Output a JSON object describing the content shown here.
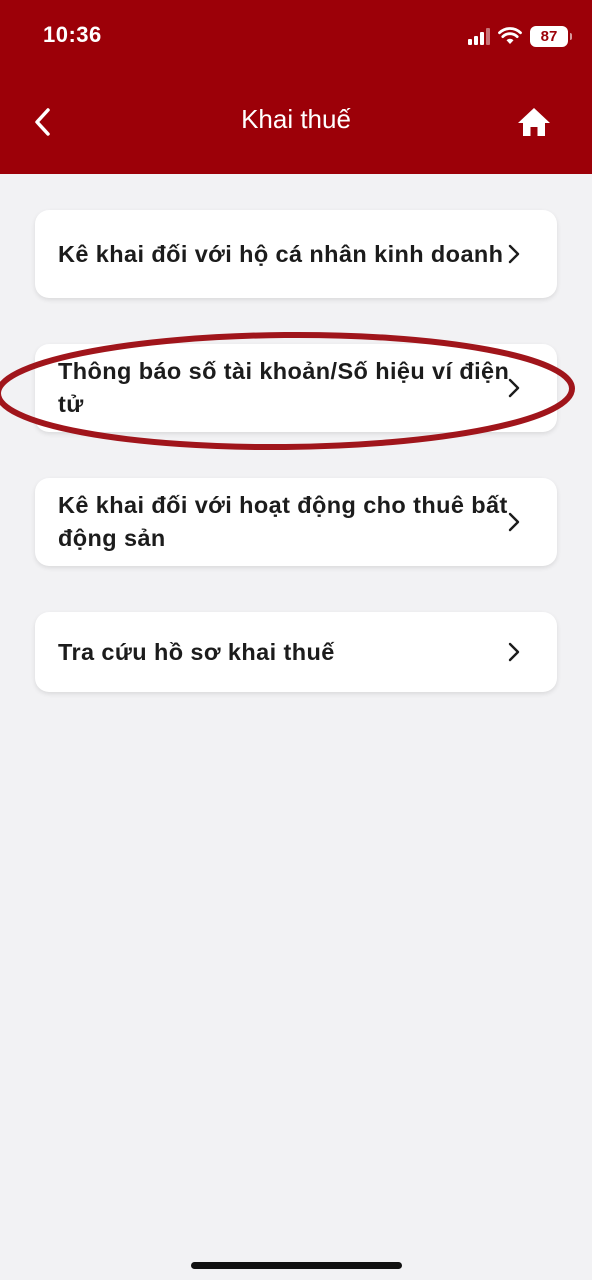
{
  "status_bar": {
    "time": "10:36",
    "battery": "87",
    "icons": [
      "signal-icon",
      "wifi-icon",
      "battery-icon"
    ]
  },
  "nav": {
    "title": "Khai thuế",
    "back_icon": "back-chevron-icon",
    "home_icon": "home-icon"
  },
  "colors": {
    "header": "#9c0008",
    "background": "#f2f2f4",
    "highlight_ellipse": "#a0151b"
  },
  "menu": {
    "items": [
      {
        "label": "Kê khai đối với hộ cá nhân kinh doanh"
      },
      {
        "label": "Thông báo số tài khoản/Số hiệu ví điện tử",
        "highlighted": true
      },
      {
        "label": "Kê khai đối với hoạt động cho thuê bất động sản"
      },
      {
        "label": "Tra cứu hồ sơ khai thuế"
      }
    ]
  }
}
